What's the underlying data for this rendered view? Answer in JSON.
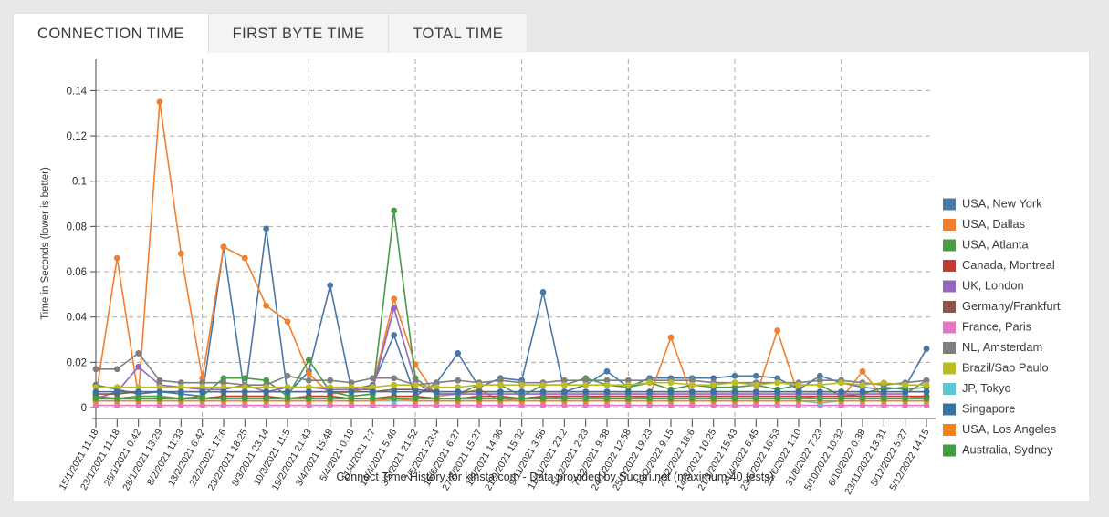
{
  "tabs": [
    {
      "label": "CONNECTION TIME",
      "active": true
    },
    {
      "label": "FIRST BYTE TIME",
      "active": false
    },
    {
      "label": "TOTAL TIME",
      "active": false
    }
  ],
  "chart_data": {
    "type": "line",
    "title": "",
    "caption": "Connect Time History for kinsta.com - Data provided by Sucuri.net (maximum 40 tests)",
    "xlabel": "",
    "ylabel": "Time in Seconds (lower is better)",
    "ylim": [
      0,
      0.145
    ],
    "yticks": [
      0,
      0.02,
      0.04,
      0.06,
      0.08,
      0.1,
      0.12,
      0.14
    ],
    "ytick_labels": [
      "0",
      "0.02",
      "0.04",
      "0.06",
      "0.08",
      "0.1",
      "0.12",
      "0.14"
    ],
    "grid": true,
    "legend_position": "right",
    "markers": true,
    "categories": [
      "15/1/2021 11:18",
      "23/1/2021 11:18",
      "25/1/2021 0:42",
      "28/1/2021 13:29",
      "8/2/2021 11:33",
      "13/2/2021 6:42",
      "22/2/2021 17:6",
      "23/2/2021 18:25",
      "8/3/2021 23:14",
      "10/3/2021 11:5",
      "19/2/2021 21:43",
      "3/4/2021 15:48",
      "5/4/2021 0:18",
      "11/4/2021 7:7",
      "14/4/2021 5:46",
      "3/5/2021 21:52",
      "7/5/2021 23:4",
      "16/6/2021 6:27",
      "27/8/2021 15:27",
      "1/9/2021 14:36",
      "21/9/2021 15:32",
      "9/11/2021 3:56",
      "11/11/2021 23:2",
      "5/12/2021 2:23",
      "7/12/2021 9:38",
      "24/1/2022 12:58",
      "25/1/2022 19:23",
      "13/2/2022 9:15",
      "23/2/2022 18:6",
      "14/3/2022 10:25",
      "21/3/2022 15:43",
      "24/4/2022 6:45",
      "23/5/2022 16:53",
      "25/6/2022 1:10",
      "31/8/2022 7:23",
      "5/10/2022 10:32",
      "6/10/2022 0:38",
      "23/11/2022 13:31",
      "5/12/2022 5:27",
      "5/12/2022 14:15"
    ],
    "series": [
      {
        "name": "USA, New York",
        "color": "#4878a8",
        "values": [
          0.01,
          0.008,
          0.006,
          0.007,
          0.006,
          0.005,
          0.071,
          0.005,
          0.079,
          0.006,
          0.016,
          0.054,
          0.008,
          0.01,
          0.032,
          0.005,
          0.011,
          0.024,
          0.009,
          0.013,
          0.012,
          0.051,
          0.007,
          0.01,
          0.016,
          0.009,
          0.013,
          0.013,
          0.013,
          0.013,
          0.014,
          0.014,
          0.013,
          0.008,
          0.014,
          0.011,
          0.009,
          0.008,
          0.009,
          0.026
        ]
      },
      {
        "name": "USA, Dallas",
        "color": "#f08030",
        "values": [
          0.005,
          0.066,
          0.005,
          0.135,
          0.068,
          0.013,
          0.071,
          0.066,
          0.045,
          0.038,
          0.015,
          0.006,
          0.007,
          0.009,
          0.048,
          0.019,
          0.005,
          0.006,
          0.008,
          0.003,
          0.004,
          0.004,
          0.005,
          0.005,
          0.004,
          0.004,
          0.005,
          0.031,
          0.005,
          0.005,
          0.005,
          0.005,
          0.034,
          0.005,
          0.004,
          0.004,
          0.016,
          0.004,
          0.004,
          0.005
        ]
      },
      {
        "name": "USA, Atlanta",
        "color": "#4a9a47",
        "values": [
          0.005,
          0.004,
          0.005,
          0.005,
          0.004,
          0.005,
          0.013,
          0.013,
          0.012,
          0.005,
          0.021,
          0.007,
          0.005,
          0.006,
          0.087,
          0.013,
          0.006,
          0.006,
          0.01,
          0.01,
          0.005,
          0.01,
          0.01,
          0.013,
          0.01,
          0.009,
          0.011,
          0.008,
          0.01,
          0.009,
          0.009,
          0.01,
          0.008,
          0.01,
          0.01,
          0.005,
          0.006,
          0.009,
          0.008,
          0.009
        ]
      },
      {
        "name": "Canada, Montreal",
        "color": "#c33a32",
        "values": [
          0.004,
          0.004,
          0.004,
          0.004,
          0.004,
          0.004,
          0.005,
          0.005,
          0.005,
          0.004,
          0.005,
          0.005,
          0.004,
          0.004,
          0.005,
          0.005,
          0.004,
          0.004,
          0.005,
          0.005,
          0.004,
          0.005,
          0.005,
          0.005,
          0.005,
          0.005,
          0.005,
          0.005,
          0.005,
          0.005,
          0.005,
          0.005,
          0.005,
          0.005,
          0.005,
          0.005,
          0.005,
          0.005,
          0.005,
          0.005
        ]
      },
      {
        "name": "UK, London",
        "color": "#9467bd",
        "values": [
          0.004,
          0.007,
          0.018,
          0.01,
          0.009,
          0.008,
          0.008,
          0.01,
          0.007,
          0.009,
          0.009,
          0.008,
          0.008,
          0.008,
          0.044,
          0.011,
          0.006,
          0.006,
          0.006,
          0.006,
          0.006,
          0.006,
          0.006,
          0.006,
          0.006,
          0.006,
          0.006,
          0.006,
          0.006,
          0.006,
          0.006,
          0.006,
          0.006,
          0.006,
          0.006,
          0.006,
          0.006,
          0.006,
          0.006,
          0.012
        ]
      },
      {
        "name": "Germany/Frankfurt",
        "color": "#8c564b",
        "values": [
          0.006,
          0.006,
          0.007,
          0.007,
          0.007,
          0.007,
          0.007,
          0.007,
          0.007,
          0.007,
          0.007,
          0.007,
          0.007,
          0.007,
          0.008,
          0.008,
          0.007,
          0.007,
          0.007,
          0.007,
          0.007,
          0.007,
          0.007,
          0.007,
          0.007,
          0.007,
          0.007,
          0.007,
          0.007,
          0.007,
          0.007,
          0.007,
          0.007,
          0.007,
          0.007,
          0.007,
          0.007,
          0.007,
          0.007,
          0.007
        ]
      },
      {
        "name": "France, Paris",
        "color": "#e377c2",
        "values": [
          0.001,
          0.001,
          0.001,
          0.001,
          0.001,
          0.001,
          0.001,
          0.001,
          0.001,
          0.001,
          0.001,
          0.001,
          0.001,
          0.001,
          0.001,
          0.001,
          0.001,
          0.001,
          0.001,
          0.001,
          0.001,
          0.001,
          0.001,
          0.001,
          0.001,
          0.001,
          0.001,
          0.001,
          0.001,
          0.001,
          0.001,
          0.001,
          0.001,
          0.001,
          0.001,
          0.001,
          0.001,
          0.001,
          0.001,
          0.001
        ]
      },
      {
        "name": "NL, Amsterdam",
        "color": "#7f7f7f",
        "values": [
          0.017,
          0.017,
          0.024,
          0.012,
          0.011,
          0.011,
          0.011,
          0.01,
          0.01,
          0.014,
          0.012,
          0.012,
          0.011,
          0.013,
          0.013,
          0.01,
          0.011,
          0.012,
          0.011,
          0.012,
          0.011,
          0.011,
          0.012,
          0.012,
          0.012,
          0.012,
          0.012,
          0.012,
          0.012,
          0.011,
          0.011,
          0.011,
          0.011,
          0.011,
          0.012,
          0.012,
          0.011,
          0.01,
          0.011,
          0.012
        ]
      },
      {
        "name": "Brazil/Sao Paulo",
        "color": "#bcbd22",
        "values": [
          0.009,
          0.009,
          0.009,
          0.009,
          0.009,
          0.009,
          0.009,
          0.009,
          0.009,
          0.009,
          0.009,
          0.009,
          0.009,
          0.009,
          0.01,
          0.01,
          0.009,
          0.009,
          0.01,
          0.01,
          0.01,
          0.01,
          0.01,
          0.01,
          0.01,
          0.01,
          0.011,
          0.011,
          0.01,
          0.01,
          0.011,
          0.01,
          0.011,
          0.01,
          0.01,
          0.011,
          0.01,
          0.011,
          0.01,
          0.01
        ]
      },
      {
        "name": "JP, Tokyo",
        "color": "#5bc8d8",
        "values": [
          0.003,
          0.003,
          0.003,
          0.003,
          0.003,
          0.003,
          0.003,
          0.003,
          0.003,
          0.003,
          0.003,
          0.003,
          0.003,
          0.003,
          0.003,
          0.003,
          0.003,
          0.003,
          0.003,
          0.003,
          0.003,
          0.003,
          0.003,
          0.003,
          0.003,
          0.003,
          0.003,
          0.003,
          0.003,
          0.003,
          0.003,
          0.003,
          0.003,
          0.003,
          0.002,
          0.003,
          0.003,
          0.003,
          0.003,
          0.003
        ]
      },
      {
        "name": "Singapore",
        "color": "#3572a5",
        "values": [
          0.007,
          0.007,
          0.007,
          0.007,
          0.007,
          0.007,
          0.007,
          0.007,
          0.007,
          0.007,
          0.007,
          0.007,
          0.007,
          0.007,
          0.007,
          0.007,
          0.007,
          0.007,
          0.007,
          0.007,
          0.007,
          0.007,
          0.007,
          0.007,
          0.007,
          0.007,
          0.007,
          0.007,
          0.007,
          0.007,
          0.007,
          0.007,
          0.007,
          0.007,
          0.007,
          0.007,
          0.007,
          0.007,
          0.007,
          0.007
        ]
      },
      {
        "name": "USA, Los Angeles",
        "color": "#f5821f",
        "values": [
          0.003,
          0.003,
          0.003,
          0.003,
          0.003,
          0.003,
          0.003,
          0.003,
          0.003,
          0.003,
          0.003,
          0.003,
          0.003,
          0.003,
          0.004,
          0.003,
          0.003,
          0.003,
          0.003,
          0.003,
          0.003,
          0.003,
          0.003,
          0.003,
          0.003,
          0.003,
          0.003,
          0.003,
          0.003,
          0.003,
          0.003,
          0.003,
          0.003,
          0.003,
          0.003,
          0.003,
          0.003,
          0.003,
          0.003,
          0.003
        ]
      },
      {
        "name": "Australia, Sydney",
        "color": "#3e9e40",
        "values": [
          0.004,
          0.004,
          0.004,
          0.004,
          0.004,
          0.004,
          0.004,
          0.004,
          0.004,
          0.004,
          0.004,
          0.004,
          0.004,
          0.004,
          0.004,
          0.004,
          0.004,
          0.004,
          0.004,
          0.004,
          0.004,
          0.004,
          0.004,
          0.004,
          0.004,
          0.004,
          0.004,
          0.004,
          0.004,
          0.004,
          0.004,
          0.004,
          0.004,
          0.004,
          0.004,
          0.004,
          0.004,
          0.004,
          0.004,
          0.004
        ]
      }
    ]
  }
}
